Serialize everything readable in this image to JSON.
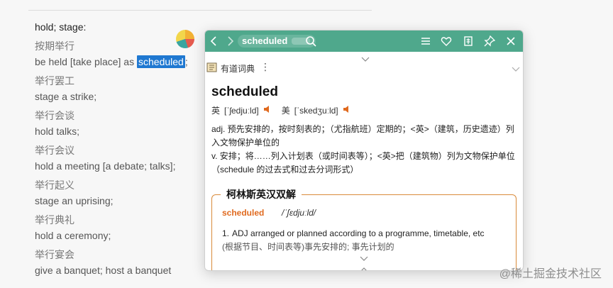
{
  "background_list": {
    "heading": "hold; stage:",
    "entries": [
      {
        "cn": "按期举行",
        "en_before": "be held [take place] as ",
        "en_highlight": "scheduled",
        "en_after": ";"
      },
      {
        "cn": "举行罢工",
        "en": "stage a strike;"
      },
      {
        "cn": "举行会谈",
        "en": "hold talks;"
      },
      {
        "cn": "举行会议",
        "en": "hold a meeting [a debate; talks];"
      },
      {
        "cn": "举行起义",
        "en": "stage an uprising;"
      },
      {
        "cn": "举行典礼",
        "en": "hold a ceremony;"
      },
      {
        "cn": "举行宴会",
        "en": "give a banquet; host a banquet"
      }
    ],
    "highlight_color": "#1f78d1"
  },
  "popup": {
    "toolbar": {
      "search_value": "scheduled",
      "icons": [
        "back-arrow-icon",
        "forward-arrow-icon",
        "search-icon",
        "menu-icon",
        "heart-icon",
        "book-icon",
        "pin-icon",
        "close-icon"
      ],
      "bg_color": "#4fa88c"
    },
    "dict_source": {
      "title": "有道词典",
      "more": "⋮"
    },
    "entry": {
      "word": "scheduled",
      "uk_label": "英",
      "uk_ipa": "[ˈʃedjuːld]",
      "us_label": "美",
      "us_ipa": "[ˈskedʒuːld]",
      "definitions": [
        "adj. 预先安排的，按时刻表的；（尤指航班）定期的；<英>（建筑，历史遗迹）列入文物保护单位的",
        "v. 安排；将……列入计划表（或时间表等）；<英>把（建筑物）列为文物保护单位（schedule 的过去式和过去分词形式）"
      ]
    },
    "collins": {
      "title": "柯林斯英汉双解",
      "word": "scheduled",
      "ipa": "/ˈʃɛdjuːld/",
      "sense_num": "1.",
      "sense_en": "ADJ arranged or planned according to a programme, timetable, etc",
      "sense_cn": "(根据节目、时间表等)事先安排的; 事先计划的"
    },
    "accent_color": "#e06a1f"
  },
  "watermark": "@稀土掘金技术社区"
}
